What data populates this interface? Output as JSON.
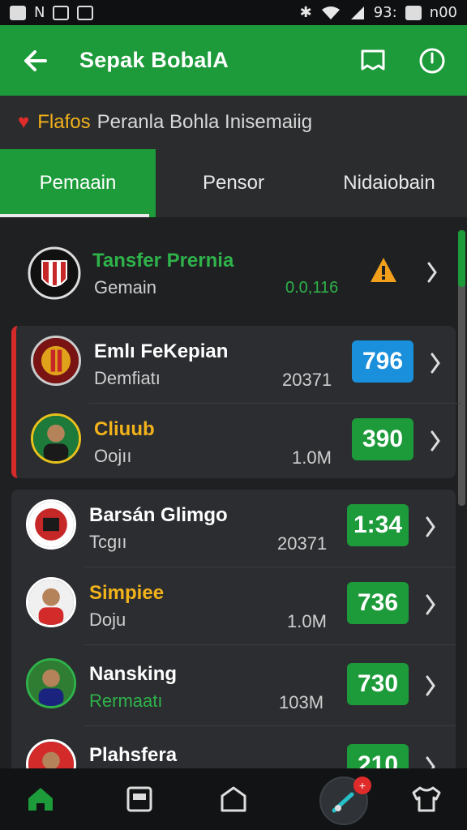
{
  "status_bar": {
    "left_text": "N",
    "right_text": "93:",
    "time": "n00",
    "icons": [
      "box-icon",
      "n-icon",
      "photo-icon",
      "media-icon",
      "bluetooth-icon",
      "wifi-icon",
      "signal-icon",
      "battery-icon"
    ]
  },
  "app_bar": {
    "title": "Sepak BobalA",
    "back_icon": "arrow-left-icon",
    "bookmark_icon": "bookmark-icon",
    "power_icon": "power-icon",
    "color": "#1d9a3a"
  },
  "notice": {
    "icon": "heart-icon",
    "highlight": "Flafos",
    "text": "Peranla Bohla Inisemaiig"
  },
  "tabs": [
    {
      "label": "Pemaain",
      "active": true
    },
    {
      "label": "Pensor",
      "active": false
    },
    {
      "label": "Nidaiobain",
      "active": false
    }
  ],
  "featured": {
    "title": "Tansfer Prernia",
    "subtitle": "Gemain",
    "value": "0.0,116",
    "warning_icon": "warning-icon"
  },
  "cards": [
    {
      "accent": "red",
      "rows": [
        {
          "name": "Emlı FeKepian",
          "pos": "Demfiatı",
          "stat": "20371",
          "badge": "796",
          "badge_color": "blue",
          "name_color": "white"
        },
        {
          "name": "Cliuub",
          "pos": "Oojıı",
          "stat": "1.0M",
          "badge": "390",
          "badge_color": "green",
          "name_color": "gold"
        }
      ]
    },
    {
      "accent": "none",
      "rows": [
        {
          "name": "Barsán Glimgo",
          "pos": "Tcgıı",
          "stat": "20371",
          "badge": "1:34",
          "badge_color": "green",
          "name_color": "white"
        },
        {
          "name": "Simpiee",
          "pos": "Doju",
          "stat": "1.0M",
          "badge": "736",
          "badge_color": "green",
          "name_color": "gold"
        },
        {
          "name": "Nansking",
          "pos": "Rermaatı",
          "stat": "103M",
          "badge": "730",
          "badge_color": "green",
          "name_color": "white",
          "pos_color": "green"
        },
        {
          "name": "Plahsfera",
          "pos": "",
          "stat": "",
          "badge": "210",
          "badge_color": "green",
          "name_color": "white"
        }
      ]
    }
  ],
  "bottom_nav": {
    "items": [
      "home-icon",
      "news-icon",
      "stadium-icon",
      "whistle-icon",
      "shirt-icon"
    ],
    "fab_badge": "+"
  }
}
